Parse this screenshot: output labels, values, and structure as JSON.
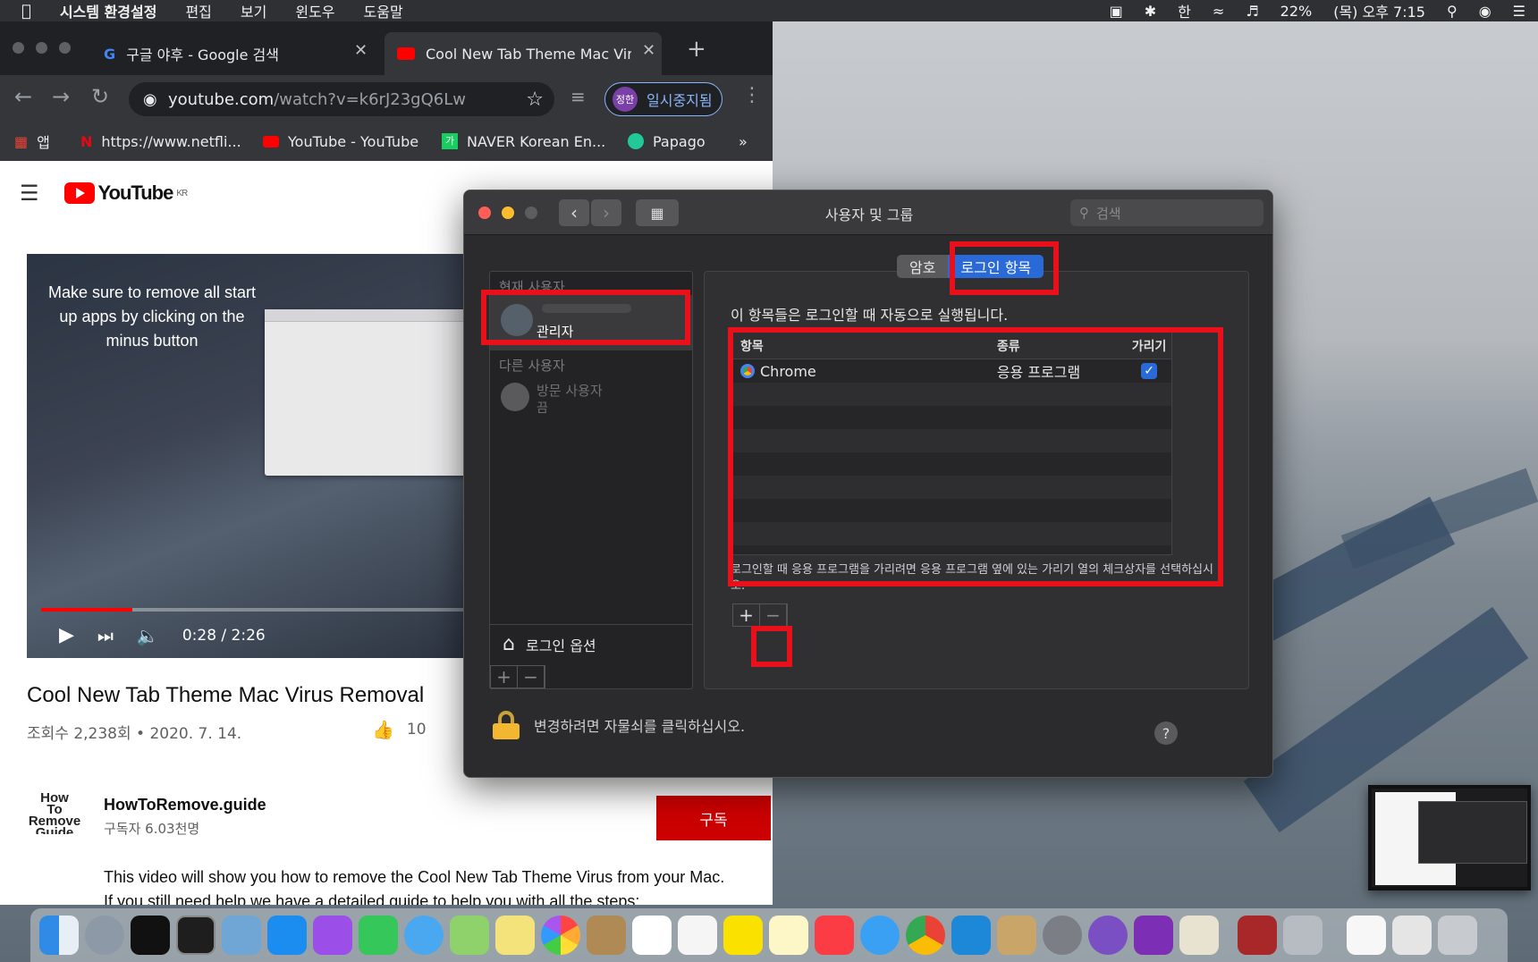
{
  "menubar": {
    "app_name": "시스템 환경설정",
    "items": [
      "편집",
      "보기",
      "윈도우",
      "도움말"
    ],
    "ime": "한",
    "battery": "22%",
    "clock": "(목) 오후 7:15"
  },
  "browser": {
    "tabs": [
      {
        "title": "구글 야후 - Google 검색"
      },
      {
        "title": "Cool New Tab Theme Mac Viru"
      }
    ],
    "url_host": "youtube.com",
    "url_path": "/watch?v=k6rJ23gQ6Lw",
    "profile_initials": "정한",
    "profile_status": "일시중지됨",
    "bookmarks": [
      {
        "label": "앱"
      },
      {
        "label": "https://www.netfli..."
      },
      {
        "label": "YouTube - YouTube"
      },
      {
        "label": "NAVER Korean En..."
      },
      {
        "label": "Papago"
      }
    ],
    "bookmarks_overflow": "»"
  },
  "youtube": {
    "logo_text": "YouTube",
    "region": "KR",
    "video_overlay_text": "Make sure to remove all start up apps by clicking on the minus button",
    "time": "0:28 / 2:26",
    "progress": 0.2,
    "title": "Cool New Tab Theme Mac Virus Removal",
    "meta": "조회수 2,238회 • 2020. 7. 14.",
    "likes": "10",
    "channel": "HowToRemove.guide",
    "subscribers": "구독자 6.03천명",
    "channel_logo_lines": [
      "How",
      "To",
      "Remove",
      "Guide"
    ],
    "subscribe": "구독",
    "description": "This video will show you how to remove the Cool New Tab Theme Virus from your Mac. If you still need help we have a detailed guide to help you with all the steps:"
  },
  "prefs": {
    "window_title": "사용자 및 그룹",
    "search_placeholder": "검색",
    "current_users_label": "현재 사용자",
    "current_user_role": "관리자",
    "other_users_label": "다른 사용자",
    "guest_name": "방문 사용자",
    "guest_status": "끔",
    "login_options": "로그인 옵션",
    "tabs": [
      "암호",
      "로그인 항목"
    ],
    "active_tab": "로그인 항목",
    "note": "이 항목들은 로그인할 때 자동으로 실행됩니다.",
    "columns": [
      "항목",
      "종류",
      "가리기"
    ],
    "items": [
      {
        "name": "Chrome",
        "kind": "응용 프로그램",
        "hide": true
      }
    ],
    "hint": "로그인할 때 응용 프로그램을 가리려면 응용 프로그램 옆에 있는 가리기 열의 체크상자를 선택하십시오.",
    "add": "+",
    "remove": "−",
    "lock_text": "변경하려면 자물쇠를 클릭하십시오.",
    "help": "?"
  },
  "colors": {
    "highlight": "#e8101a",
    "accent": "#2a6ad8",
    "youtube_red": "#ff0000"
  }
}
